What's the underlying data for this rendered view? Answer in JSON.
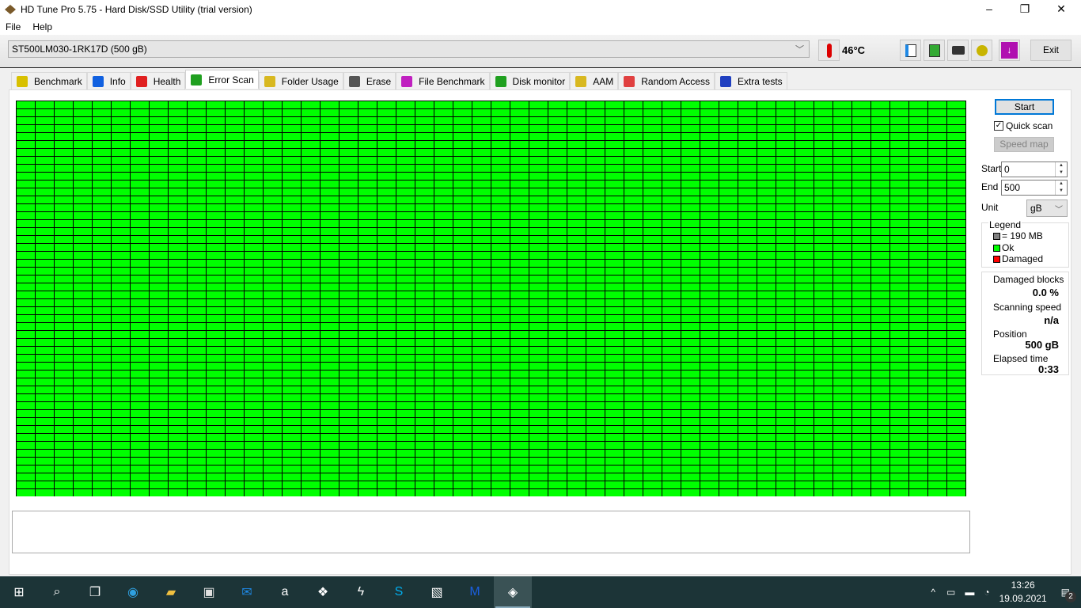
{
  "window": {
    "title": "HD Tune Pro 5.75 - Hard Disk/SSD Utility (trial version)",
    "minimize": "–",
    "maximize": "❐",
    "close": "✕"
  },
  "menu": [
    "File",
    "Help"
  ],
  "toolbar": {
    "drive": "ST500LM030-1RK17D (500 gB)",
    "temperature": "46°C",
    "exit": "Exit"
  },
  "tabs": [
    {
      "label": "Benchmark",
      "icon": "lightbulb-icon",
      "color": "#d8c000"
    },
    {
      "label": "Info",
      "icon": "info-icon",
      "color": "#1060e0"
    },
    {
      "label": "Health",
      "icon": "health-cross-icon",
      "color": "#e02020"
    },
    {
      "label": "Error Scan",
      "icon": "magnifier-icon",
      "color": "#20a020"
    },
    {
      "label": "Folder Usage",
      "icon": "folder-icon",
      "color": "#d8b820"
    },
    {
      "label": "Erase",
      "icon": "trash-icon",
      "color": "#555555"
    },
    {
      "label": "File Benchmark",
      "icon": "file-benchmark-icon",
      "color": "#c020c0"
    },
    {
      "label": "Disk monitor",
      "icon": "disk-monitor-icon",
      "color": "#20a020"
    },
    {
      "label": "AAM",
      "icon": "speaker-icon",
      "color": "#d8b820"
    },
    {
      "label": "Random Access",
      "icon": "random-access-icon",
      "color": "#e04040"
    },
    {
      "label": "Extra tests",
      "icon": "extra-tests-icon",
      "color": "#2040c0"
    }
  ],
  "active_tab": "Error Scan",
  "scan": {
    "rows": 50,
    "cols": 50,
    "ok_color": "#00ff00",
    "damaged_color": "#ff0000"
  },
  "side": {
    "start_button": "Start",
    "quick_scan": "Quick scan",
    "quick_scan_checked": true,
    "speed_map": "Speed map",
    "start_label": "Start",
    "start_value": "0",
    "end_label": "End",
    "end_value": "500",
    "unit_label": "Unit",
    "unit_value": "gB",
    "legend": {
      "title": "Legend",
      "block": "= 190 MB",
      "ok": "Ok",
      "damaged": "Damaged"
    },
    "stats": {
      "damaged_label": "Damaged blocks",
      "damaged_value": "0.0 %",
      "speed_label": "Scanning speed",
      "speed_value": "n/a",
      "position_label": "Position",
      "position_value": "500 gB",
      "elapsed_label": "Elapsed time",
      "elapsed_value": "0:33"
    }
  },
  "taskbar": {
    "apps": [
      "start",
      "search",
      "task-view",
      "edge",
      "file-explorer",
      "store",
      "mail",
      "amazon",
      "dropbox",
      "app-s",
      "skype",
      "app-monitor",
      "malwarebytes",
      "hdtune"
    ],
    "time": "13:26",
    "date": "19.09.2021",
    "notifications": "2"
  }
}
